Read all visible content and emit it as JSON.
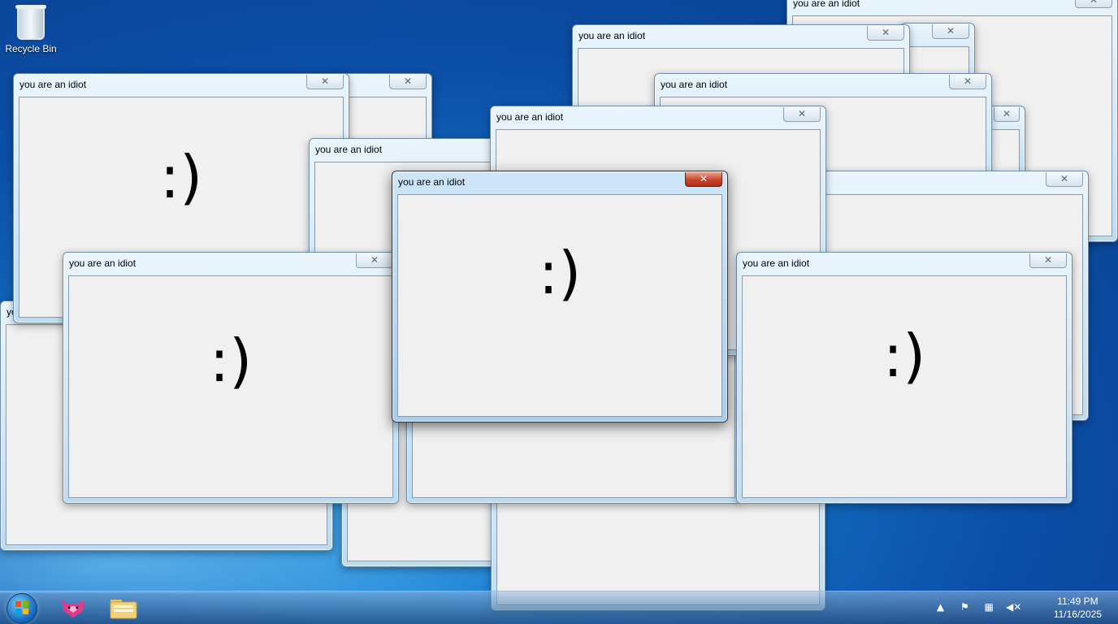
{
  "desktop": {
    "icons": [
      {
        "label": "Recycle Bin",
        "icon": "recycle-bin-icon"
      }
    ]
  },
  "popup": {
    "title": "you are an idiot",
    "close_glyph": "✕",
    "smiley": ":)"
  },
  "taskbar": {
    "start_icon": "windows-start-orb-icon",
    "pinned": [
      "browser-fox-icon",
      "folder-icon"
    ],
    "tray": {
      "show_hidden_glyph": "▲",
      "icons": [
        "action-center-flag-icon",
        "network-icon",
        "volume-muted-icon"
      ]
    },
    "clock": {
      "time": "11:49 PM",
      "date": "11/16/2025"
    }
  }
}
